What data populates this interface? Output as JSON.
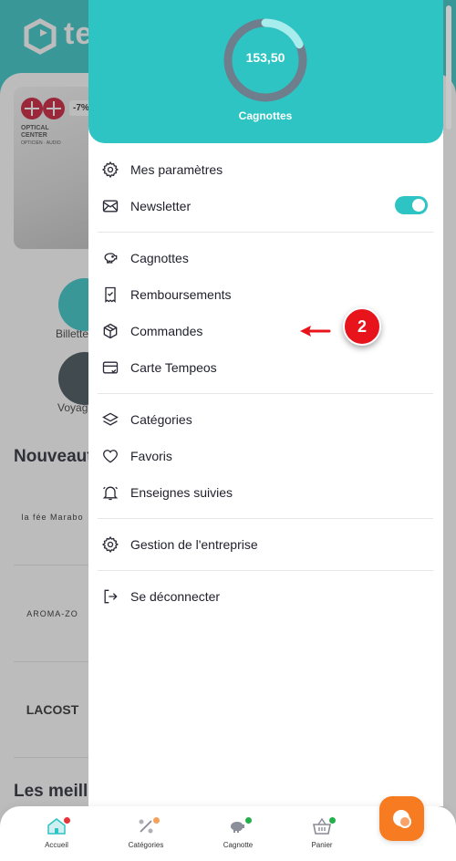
{
  "background": {
    "logo_text": "te",
    "promo_badge": "-7%",
    "promo_brand_line1": "OPTICAL",
    "promo_brand_line2": "CENTER",
    "promo_brand_line3": "OPTICIEN · AUDIO",
    "shortcut_1_label": "Billette",
    "shortcut_2_label": "Voyag",
    "section_title_1": "Nouveaut",
    "section_title_2": "Les meille",
    "brand_1": "la fée Marabo",
    "brand_2": "AROMA-ZO",
    "brand_3": "LACOST"
  },
  "drawer": {
    "balance": "153,50",
    "balance_label": "Cagnottes",
    "gauge_fraction": 0.18,
    "menu": {
      "settings": "Mes paramètres",
      "newsletter": "Newsletter",
      "newsletter_enabled": true,
      "cagnottes": "Cagnottes",
      "remboursements": "Remboursements",
      "commandes": "Commandes",
      "carte": "Carte Tempeos",
      "categories": "Catégories",
      "favoris": "Favoris",
      "enseignes": "Enseignes suivies",
      "gestion": "Gestion de l'entreprise",
      "logout": "Se déconnecter"
    }
  },
  "annotation": {
    "step_number": "2"
  },
  "bottom_nav": {
    "accueil": "Accueil",
    "categories": "Catégories",
    "cagnotte": "Cagnotte",
    "panier": "Panier"
  },
  "colors": {
    "teal": "#2ec4c4",
    "orange": "#f77b20",
    "annotation_red": "#e8141c",
    "dot_green": "#23b04a",
    "dot_red": "#e5343a"
  }
}
